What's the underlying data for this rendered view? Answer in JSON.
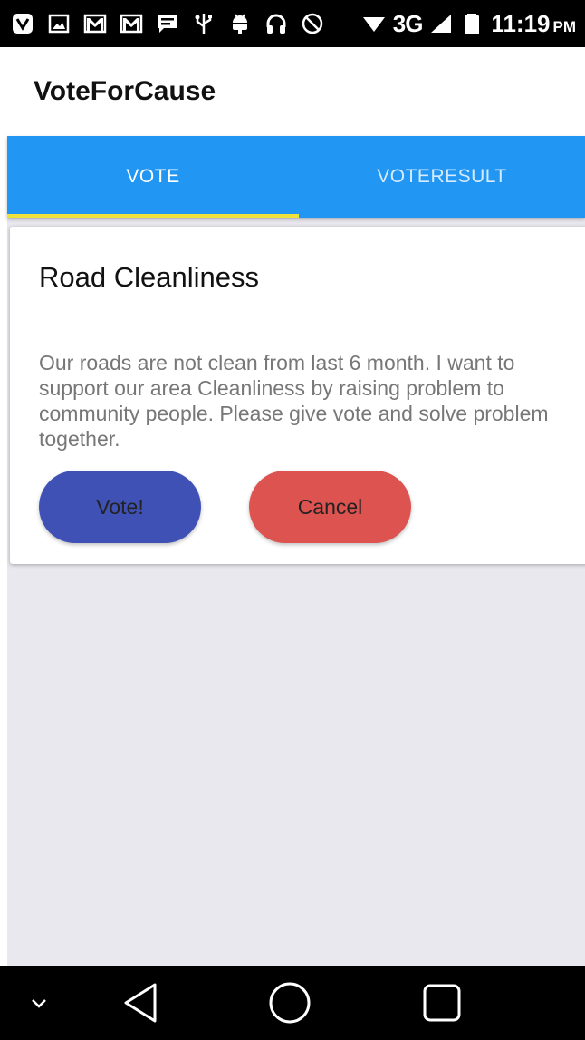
{
  "status_bar": {
    "network_label": "3G",
    "time": "11:19",
    "ampm": "PM",
    "icons": [
      "saavn-icon",
      "image-icon",
      "gmail-icon",
      "gmail-icon",
      "message-icon",
      "usb-icon",
      "android-debug-icon",
      "headphones-icon",
      "do-not-disturb-icon",
      "wifi-icon",
      "signal-icon",
      "battery-icon"
    ]
  },
  "app_bar": {
    "title": "VoteForCause"
  },
  "tabs": [
    {
      "label": "VOTE",
      "selected": true
    },
    {
      "label": "VOTERESULT",
      "selected": false
    }
  ],
  "card": {
    "title": "Road Cleanliness",
    "description": "Our roads are not clean from last 6 month. I want to support our area Cleanliness by raising problem to community people. Please give vote and solve problem together.",
    "vote_label": "Vote!",
    "cancel_label": "Cancel"
  },
  "colors": {
    "tab_bar": "#2196f3",
    "tab_indicator": "#ede13a",
    "vote_button": "#3f51b5",
    "cancel_button": "#dc5350",
    "background": "#e9e8ee"
  },
  "nav_bar": {
    "icons": [
      "chevron-down-icon",
      "back-icon",
      "home-icon",
      "recents-icon"
    ]
  }
}
